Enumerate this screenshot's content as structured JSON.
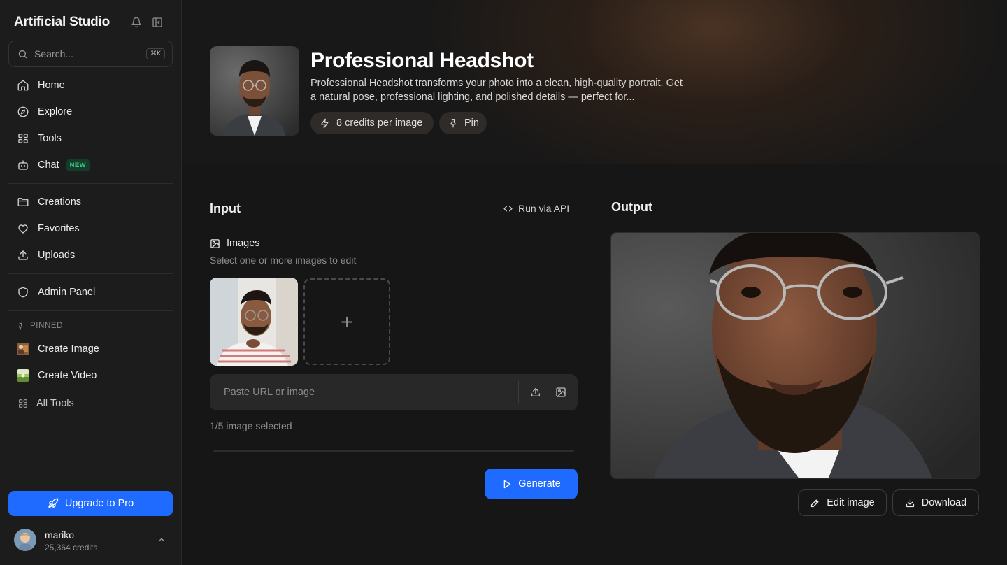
{
  "app": {
    "brand": "Artificial Studio"
  },
  "search": {
    "placeholder": "Search...",
    "shortcut": "⌘K"
  },
  "nav": {
    "main": [
      {
        "label": "Home",
        "icon": "home-icon"
      },
      {
        "label": "Explore",
        "icon": "compass-icon"
      },
      {
        "label": "Tools",
        "icon": "grid-icon"
      },
      {
        "label": "Chat",
        "icon": "bot-icon",
        "badge": "NEW"
      }
    ],
    "library": [
      {
        "label": "Creations",
        "icon": "folder-icon"
      },
      {
        "label": "Favorites",
        "icon": "heart-icon"
      },
      {
        "label": "Uploads",
        "icon": "upload-icon"
      }
    ],
    "admin": {
      "label": "Admin Panel",
      "icon": "shield-icon"
    },
    "pinned_heading": "PINNED",
    "pinned": [
      {
        "label": "Create Image",
        "icon": "image-thumb"
      },
      {
        "label": "Create Video",
        "icon": "video-thumb"
      },
      {
        "label": "All Tools",
        "icon": "grid-icon"
      }
    ]
  },
  "sidebar_footer": {
    "upgrade_label": "Upgrade to Pro",
    "username": "mariko",
    "credits": "25,364 credits"
  },
  "hero": {
    "title": "Professional Headshot",
    "description": "Professional Headshot transforms your photo into a clean, high-quality portrait. Get a natural pose, professional lighting, and polished details — perfect for...",
    "credits_chip": "8 credits per image",
    "pin_chip": "Pin"
  },
  "input": {
    "title": "Input",
    "api_link": "Run via API",
    "images_label": "Images",
    "images_hint": "Select one or more images to edit",
    "add_symbol": "+",
    "url_placeholder": "Paste URL or image",
    "selection_status": "1/5 image selected",
    "generate_label": "Generate"
  },
  "output": {
    "title": "Output",
    "edit_label": "Edit image",
    "download_label": "Download"
  },
  "colors": {
    "accent": "#1f6bff",
    "background": "#161616",
    "sidebar": "#1c1c1c",
    "new_badge": "#45c98a"
  }
}
